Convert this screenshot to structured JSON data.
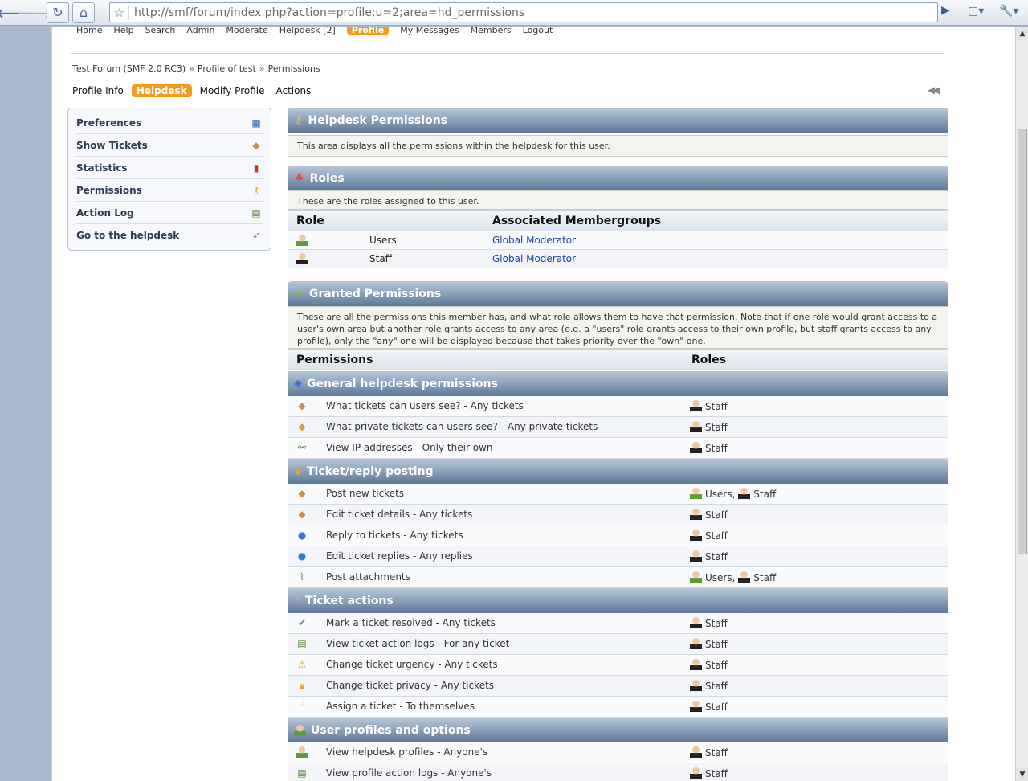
{
  "browser": {
    "url": "http://smf/forum/index.php?action=profile;u=2;area=hd_permissions",
    "icons": [
      "back-icon",
      "forward-icon",
      "reload-icon",
      "home-icon",
      "star-icon",
      "go-icon",
      "page-menu-icon",
      "tools-icon"
    ]
  },
  "top_menu": [
    "Home",
    "Help",
    "Search",
    "Admin",
    "Moderate",
    "Helpdesk [2]",
    "Profile",
    "My Messages",
    "Members",
    "Logout"
  ],
  "breadcrumb": [
    "Test Forum (SMF 2.0 RC3)",
    "Profile of test",
    "Permissions"
  ],
  "breadcrumb_sep": "»",
  "profile_tabs": [
    "Profile Info",
    "Helpdesk",
    "Modify Profile",
    "Actions"
  ],
  "side_menu": [
    {
      "label": "Preferences",
      "icon": "grid-icon"
    },
    {
      "label": "Show Tickets",
      "icon": "ticket-icon"
    },
    {
      "label": "Statistics",
      "icon": "bar-chart-icon"
    },
    {
      "label": "Permissions",
      "icon": "key-icon"
    },
    {
      "label": "Action Log",
      "icon": "log-icon"
    },
    {
      "label": "Go to the helpdesk",
      "icon": "cursor-icon"
    }
  ],
  "permissions_section": {
    "title": "Helpdesk Permissions",
    "description": "This area displays all the permissions within the helpdesk for this user."
  },
  "roles_section": {
    "title": "Roles",
    "description": "These are the roles assigned to this user.",
    "col_role": "Role",
    "col_groups": "Associated Membergroups",
    "rows": [
      {
        "name": "Users",
        "groups": "Global Moderator"
      },
      {
        "name": "Staff",
        "groups": "Global Moderator"
      }
    ]
  },
  "granted_section": {
    "title": "Granted Permissions",
    "description": "These are all the permissions this member has, and what role allows them to have that permission. Note that if one role would grant access to a user's own area but another role grants access to any area (e.g. a \"users\" role grants access to their own profile, but staff grants access to any profile), only the \"any\" one will be displayed because that takes priority over the \"own\" one.",
    "col_permissions": "Permissions",
    "col_roles": "Roles",
    "comma": ",",
    "groups": [
      {
        "title": "General helpdesk permissions",
        "rows": [
          {
            "label": "What tickets can users see? - Any tickets",
            "roles": [
              "Staff"
            ]
          },
          {
            "label": "What private tickets can users see? - Any private tickets",
            "roles": [
              "Staff"
            ]
          },
          {
            "label": "View IP addresses - Only their own",
            "roles": [
              "Staff"
            ]
          }
        ]
      },
      {
        "title": "Ticket/reply posting",
        "rows": [
          {
            "label": "Post new tickets",
            "roles": [
              "Users",
              "Staff"
            ]
          },
          {
            "label": "Edit ticket details - Any tickets",
            "roles": [
              "Staff"
            ]
          },
          {
            "label": "Reply to tickets - Any tickets",
            "roles": [
              "Staff"
            ]
          },
          {
            "label": "Edit ticket replies - Any replies",
            "roles": [
              "Staff"
            ]
          },
          {
            "label": "Post attachments",
            "roles": [
              "Users",
              "Staff"
            ]
          }
        ]
      },
      {
        "title": "Ticket actions",
        "rows": [
          {
            "label": "Mark a ticket resolved - Any tickets",
            "roles": [
              "Staff"
            ]
          },
          {
            "label": "View ticket action logs - For any ticket",
            "roles": [
              "Staff"
            ]
          },
          {
            "label": "Change ticket urgency - Any tickets",
            "roles": [
              "Staff"
            ]
          },
          {
            "label": "Change ticket privacy - Any tickets",
            "roles": [
              "Staff"
            ]
          },
          {
            "label": "Assign a ticket - To themselves",
            "roles": [
              "Staff"
            ]
          }
        ]
      },
      {
        "title": "User profiles and options",
        "rows": [
          {
            "label": "View helpdesk profiles - Anyone's",
            "roles": [
              "Staff"
            ]
          },
          {
            "label": "View profile action logs - Anyone's",
            "roles": [
              "Staff"
            ]
          }
        ]
      }
    ]
  }
}
